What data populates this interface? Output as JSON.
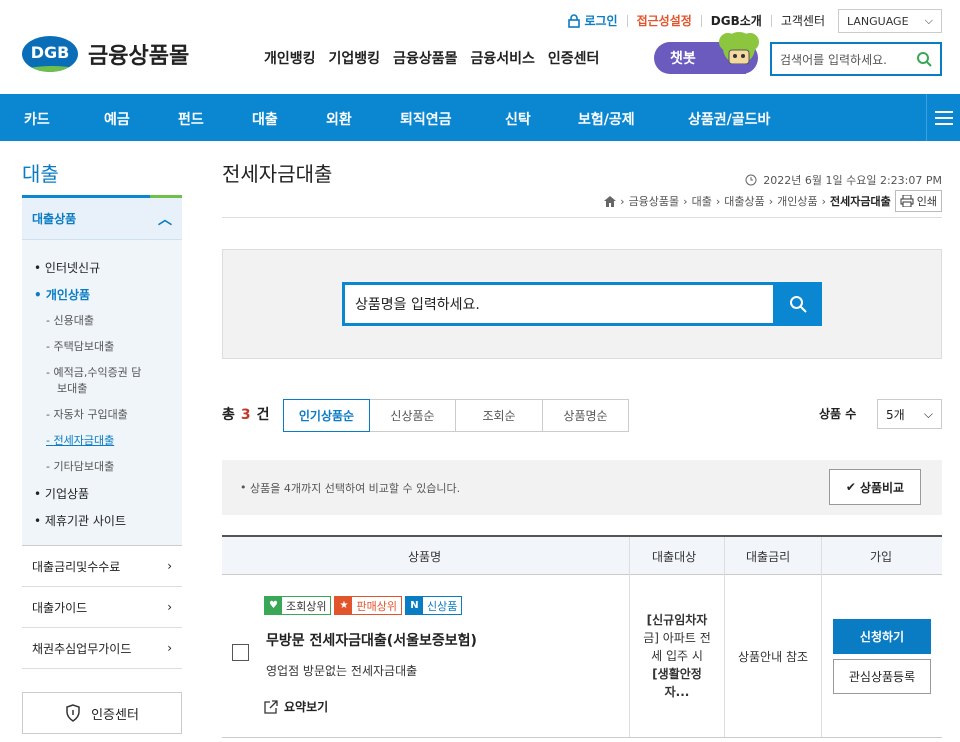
{
  "header": {
    "util": {
      "login": "로그인",
      "accessibility": "접근성설정",
      "about": "DGB소개",
      "support": "고객센터",
      "language": "LANGUAGE"
    },
    "logo": {
      "mark": "DGB",
      "name": "금융상품몰"
    },
    "gnb": [
      "개인뱅킹",
      "기업뱅킹",
      "금융상품몰",
      "금융서비스",
      "인증센터"
    ],
    "chatbot": "챗봇",
    "search_placeholder": "검색어를 입력하세요."
  },
  "menubar": [
    "카드",
    "예금",
    "펀드",
    "대출",
    "외환",
    "퇴직연금",
    "신탁",
    "보험/공제",
    "상품권/골드바"
  ],
  "sidebar": {
    "title": "대출",
    "section": "대출상품",
    "items": [
      {
        "label": "인터넷신규"
      },
      {
        "label": "개인상품"
      },
      {
        "label": "신용대출"
      },
      {
        "label": "주택담보대출"
      },
      {
        "label": "예적금,수익증권 담"
      },
      {
        "label": "보대출"
      },
      {
        "label": "자동차 구입대출"
      },
      {
        "label": "전세자금대출"
      },
      {
        "label": "기타담보대출"
      },
      {
        "label": "기업상품"
      },
      {
        "label": "제휴기관 사이트"
      }
    ],
    "menus": [
      "대출금리및수수료",
      "대출가이드",
      "채권추심업무가이드"
    ],
    "cert": "인증센터"
  },
  "content": {
    "title": "전세자금대출",
    "datetime": "2022년 6월 1일 수요일 2:23:07 PM",
    "breadcrumb": [
      "금융상품몰",
      "대출",
      "대출상품",
      "개인상품",
      "전세자금대출"
    ],
    "print": "인쇄",
    "search_placeholder": "상품명을 입력하세요.",
    "total_prefix": "총",
    "total_count": "3",
    "total_suffix": "건",
    "sorts": [
      "인기상품순",
      "신상품순",
      "조회순",
      "상품명순"
    ],
    "count_label": "상품 수",
    "count_value": "5개",
    "notice": "상품을 4개까지 선택하여 비교할 수 있습니다.",
    "compare": "상품비교",
    "table_headers": [
      "상품명",
      "대출대상",
      "대출금리",
      "가입"
    ],
    "product": {
      "badges": [
        {
          "label": "조회상위",
          "color": "#3aa757",
          "icon": "heart-icon"
        },
        {
          "label": "판매상위",
          "color": "#e2542b",
          "icon": "star-icon"
        },
        {
          "label": "신상품",
          "color": "#0a7cc4",
          "icon": "new-icon"
        }
      ],
      "name": "무방문 전세자금대출(서울보증보험)",
      "desc": "영업점 방문없는 전세자금대출",
      "summary": "요약보기",
      "target_1": "[신규임차자",
      "target_2": "금] 아파트 전",
      "target_3": "세 입주 시",
      "target_4": "[생활안정",
      "target_5": "자...",
      "rate": "상품안내 참조",
      "apply": "신청하기",
      "fav": "관심상품등록"
    }
  }
}
